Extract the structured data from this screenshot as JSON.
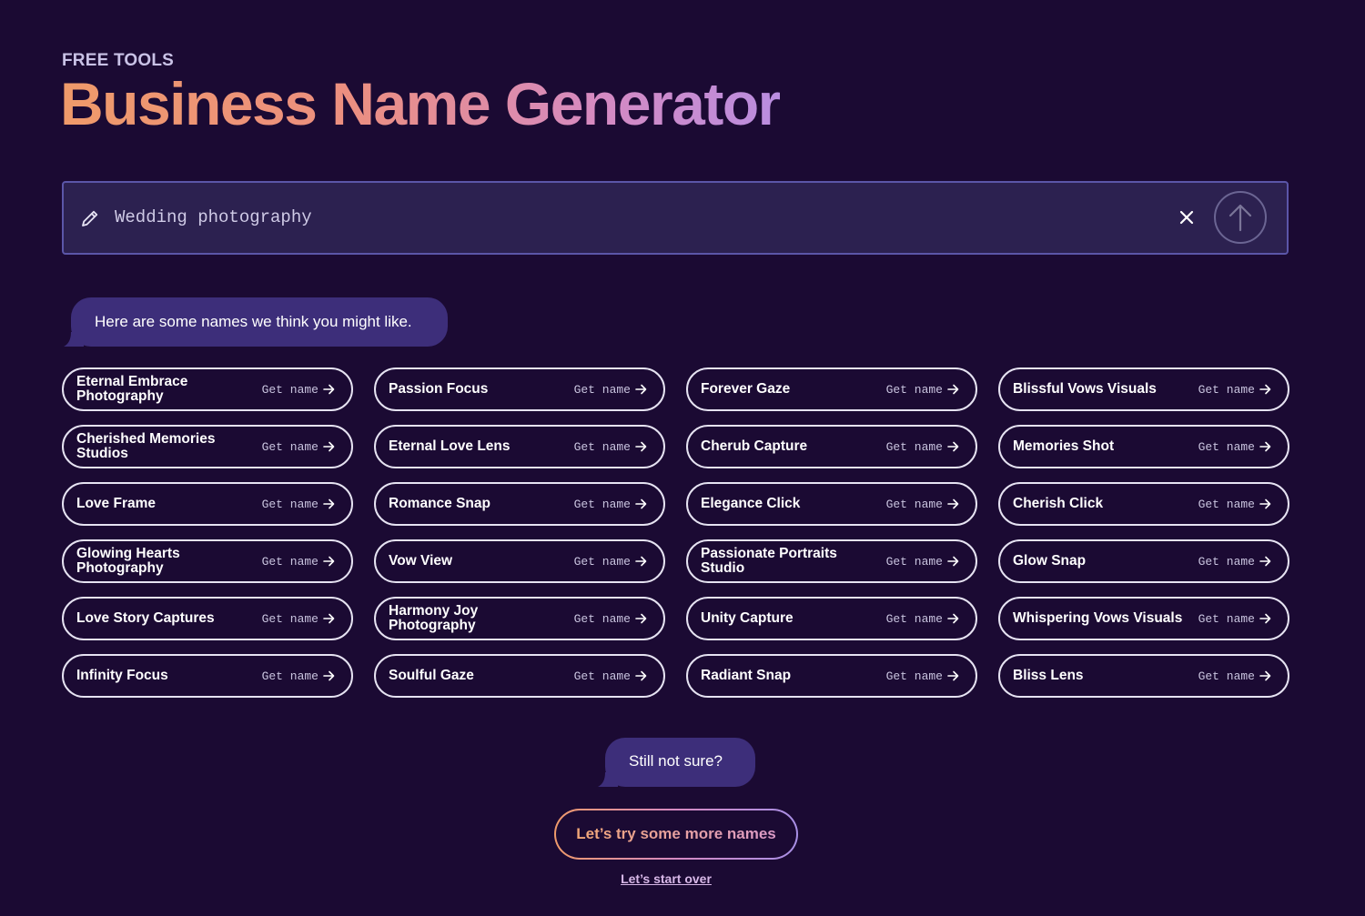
{
  "header": {
    "eyebrow": "FREE TOOLS",
    "title": "Business Name Generator"
  },
  "search": {
    "value": "Wedding photography",
    "icons": {
      "leading": "pencil-icon",
      "clear": "close-icon",
      "submit": "arrow-up-icon"
    }
  },
  "bubbles": {
    "intro": "Here are some names we think you might like.",
    "not_sure": "Still not sure?"
  },
  "get_name_label": "Get name",
  "names": [
    "Eternal Embrace Photography",
    "Passion Focus",
    "Forever Gaze",
    "Blissful Vows Visuals",
    "Cherished Memories Studios",
    "Eternal Love Lens",
    "Cherub Capture",
    "Memories Shot",
    "Love Frame",
    "Romance Snap",
    "Elegance Click",
    "Cherish Click",
    "Glowing Hearts Photography",
    "Vow View",
    "Passionate Portraits Studio",
    "Glow Snap",
    "Love Story Captures",
    "Harmony Joy Photography",
    "Unity Capture",
    "Whispering Vows Visuals",
    "Infinity Focus",
    "Soulful Gaze",
    "Radiant Snap",
    "Bliss Lens"
  ],
  "actions": {
    "more_names": "Let’s try some more names",
    "start_over": "Let’s start over"
  },
  "colors": {
    "background": "#1b0a33",
    "bubble": "#3d2e7a",
    "search_bg": "#2c2150",
    "search_border": "#5b56a8",
    "title_gradient_start": "#ef9a6a",
    "title_gradient_end": "#b98de0"
  }
}
